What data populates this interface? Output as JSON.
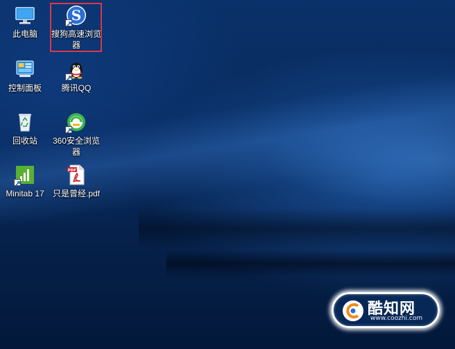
{
  "desktop": {
    "icons": [
      {
        "label": "此电脑",
        "icon": "this-pc-icon"
      },
      {
        "label": "搜狗高速浏览器",
        "icon": "sogou-browser-icon",
        "selected": true
      },
      {
        "label": "控制面板",
        "icon": "control-panel-icon"
      },
      {
        "label": "腾讯QQ",
        "icon": "qq-penguin-icon"
      },
      {
        "label": "回收站",
        "icon": "recycle-bin-icon"
      },
      {
        "label": "360安全浏览器",
        "icon": "360-browser-icon"
      },
      {
        "label": "Minitab 17",
        "icon": "minitab-icon"
      },
      {
        "label": "只是曾经.pdf",
        "icon": "pdf-file-icon"
      }
    ]
  },
  "watermark": {
    "name": "酷知网",
    "url": "www.coozhi.com",
    "logo_text": "C"
  },
  "colors": {
    "selection_border": "#d9384a",
    "wallpaper_blue": "#0a3169",
    "sogou_blue": "#2a6fd6",
    "qq_red": "#d8262c",
    "browser360_green": "#3bb34a",
    "minitab_green": "#5ab031",
    "pdf_red": "#c8242c"
  }
}
